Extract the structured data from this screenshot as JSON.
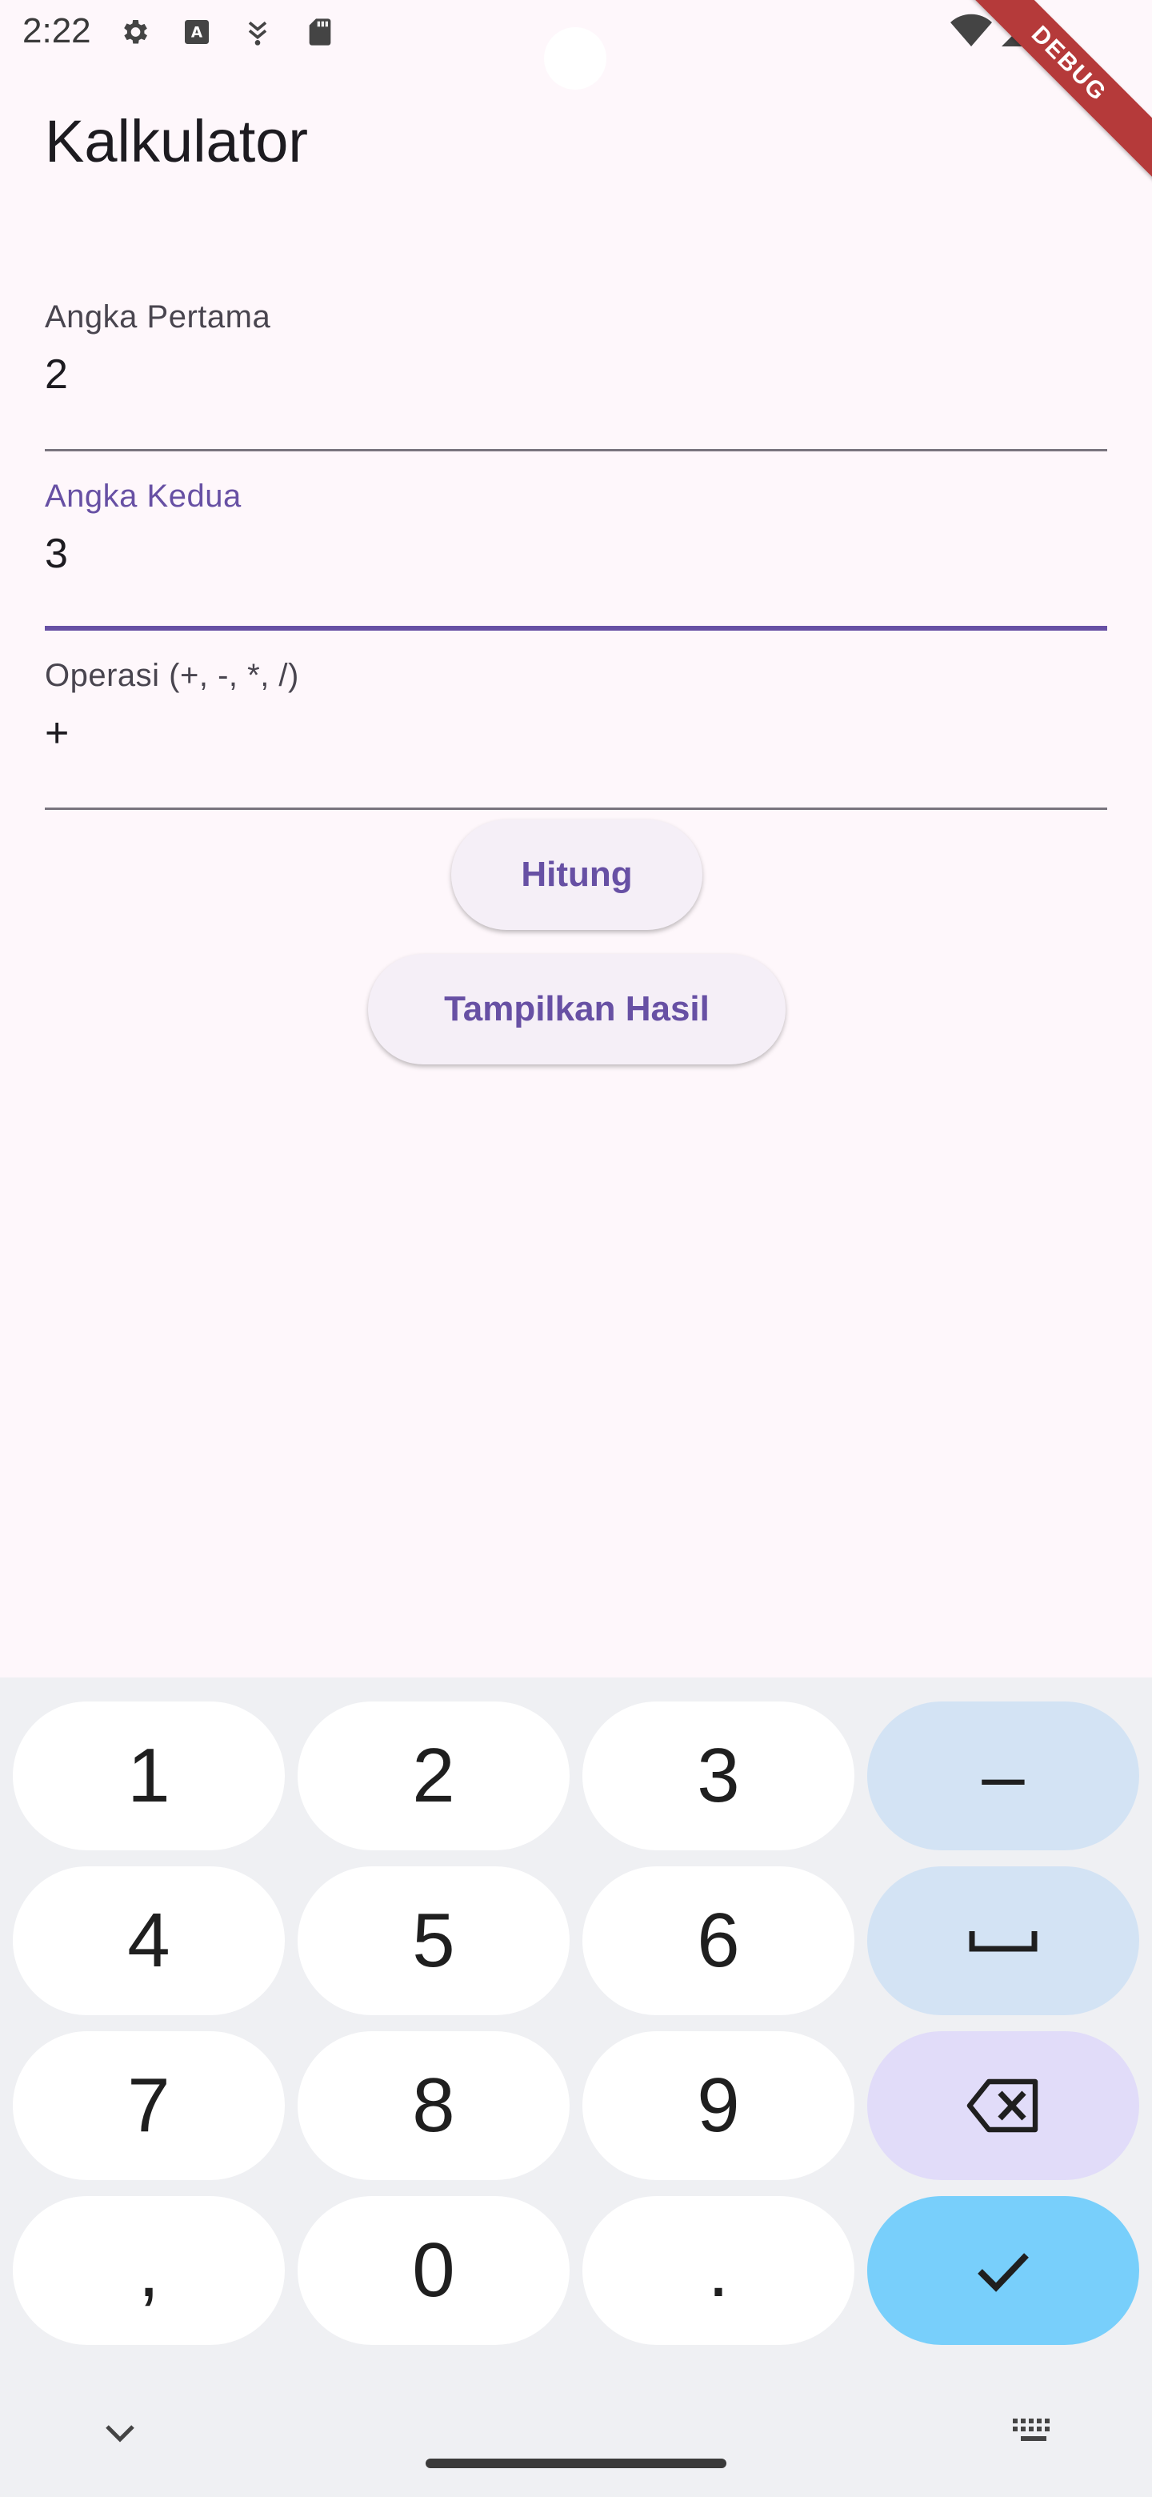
{
  "status_bar": {
    "time": "2:22",
    "icons_left": [
      "settings-gear-icon",
      "font-a-icon",
      "shield-arrow-icon",
      "sd-card-icon"
    ],
    "icons_right": [
      "wifi-icon",
      "cell-signal-icon"
    ]
  },
  "debug_banner": {
    "label": "DEBUG",
    "color": "#b53a3a"
  },
  "app": {
    "title": "Kalkulator",
    "fields": [
      {
        "label": "Angka Pertama",
        "value": "2",
        "focused": false
      },
      {
        "label": "Angka Kedua",
        "value": "3",
        "focused": true
      },
      {
        "label": "Operasi (+, -, *, /)",
        "value": "+",
        "focused": false
      }
    ],
    "buttons": {
      "calculate": "Hitung",
      "show_result": "Tampilkan Hasil"
    },
    "accent_color": "#6750a4"
  },
  "keyboard": {
    "rows": [
      [
        "1",
        "2",
        "3",
        "–"
      ],
      [
        "4",
        "5",
        "6",
        "␣"
      ],
      [
        "7",
        "8",
        "9",
        "⌫"
      ],
      [
        ",",
        "0",
        ".",
        "✓"
      ]
    ],
    "bottom_left_icon": "chevron-down-icon",
    "bottom_right_icon": "keyboard-icon"
  }
}
